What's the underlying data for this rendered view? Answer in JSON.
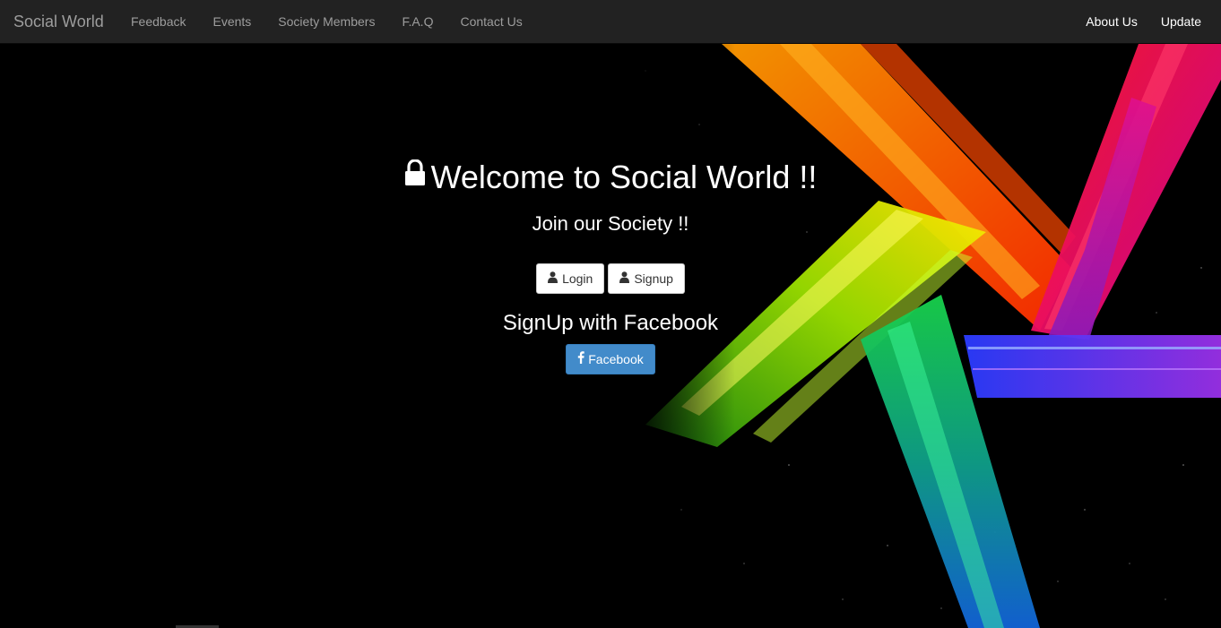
{
  "navbar": {
    "brand": "Social World",
    "left_items": [
      "Feedback",
      "Events",
      "Society Members",
      "F.A.Q",
      "Contact Us"
    ],
    "right_items": [
      "About Us",
      "Update"
    ]
  },
  "hero": {
    "title": "Welcome to Social World !!",
    "subtitle": "Join our Society !!",
    "login_label": "Login",
    "signup_label": "Signup",
    "facebook_heading": "SignUp with Facebook",
    "facebook_label": "Facebook"
  },
  "icons": {
    "title": "lock-icon",
    "login": "user-icon",
    "signup": "user-icon",
    "facebook": "facebook-icon"
  },
  "colors": {
    "navbar_bg": "#222222",
    "nav_text": "#9d9d9d",
    "facebook_button": "#428bca",
    "background": "#000000"
  }
}
